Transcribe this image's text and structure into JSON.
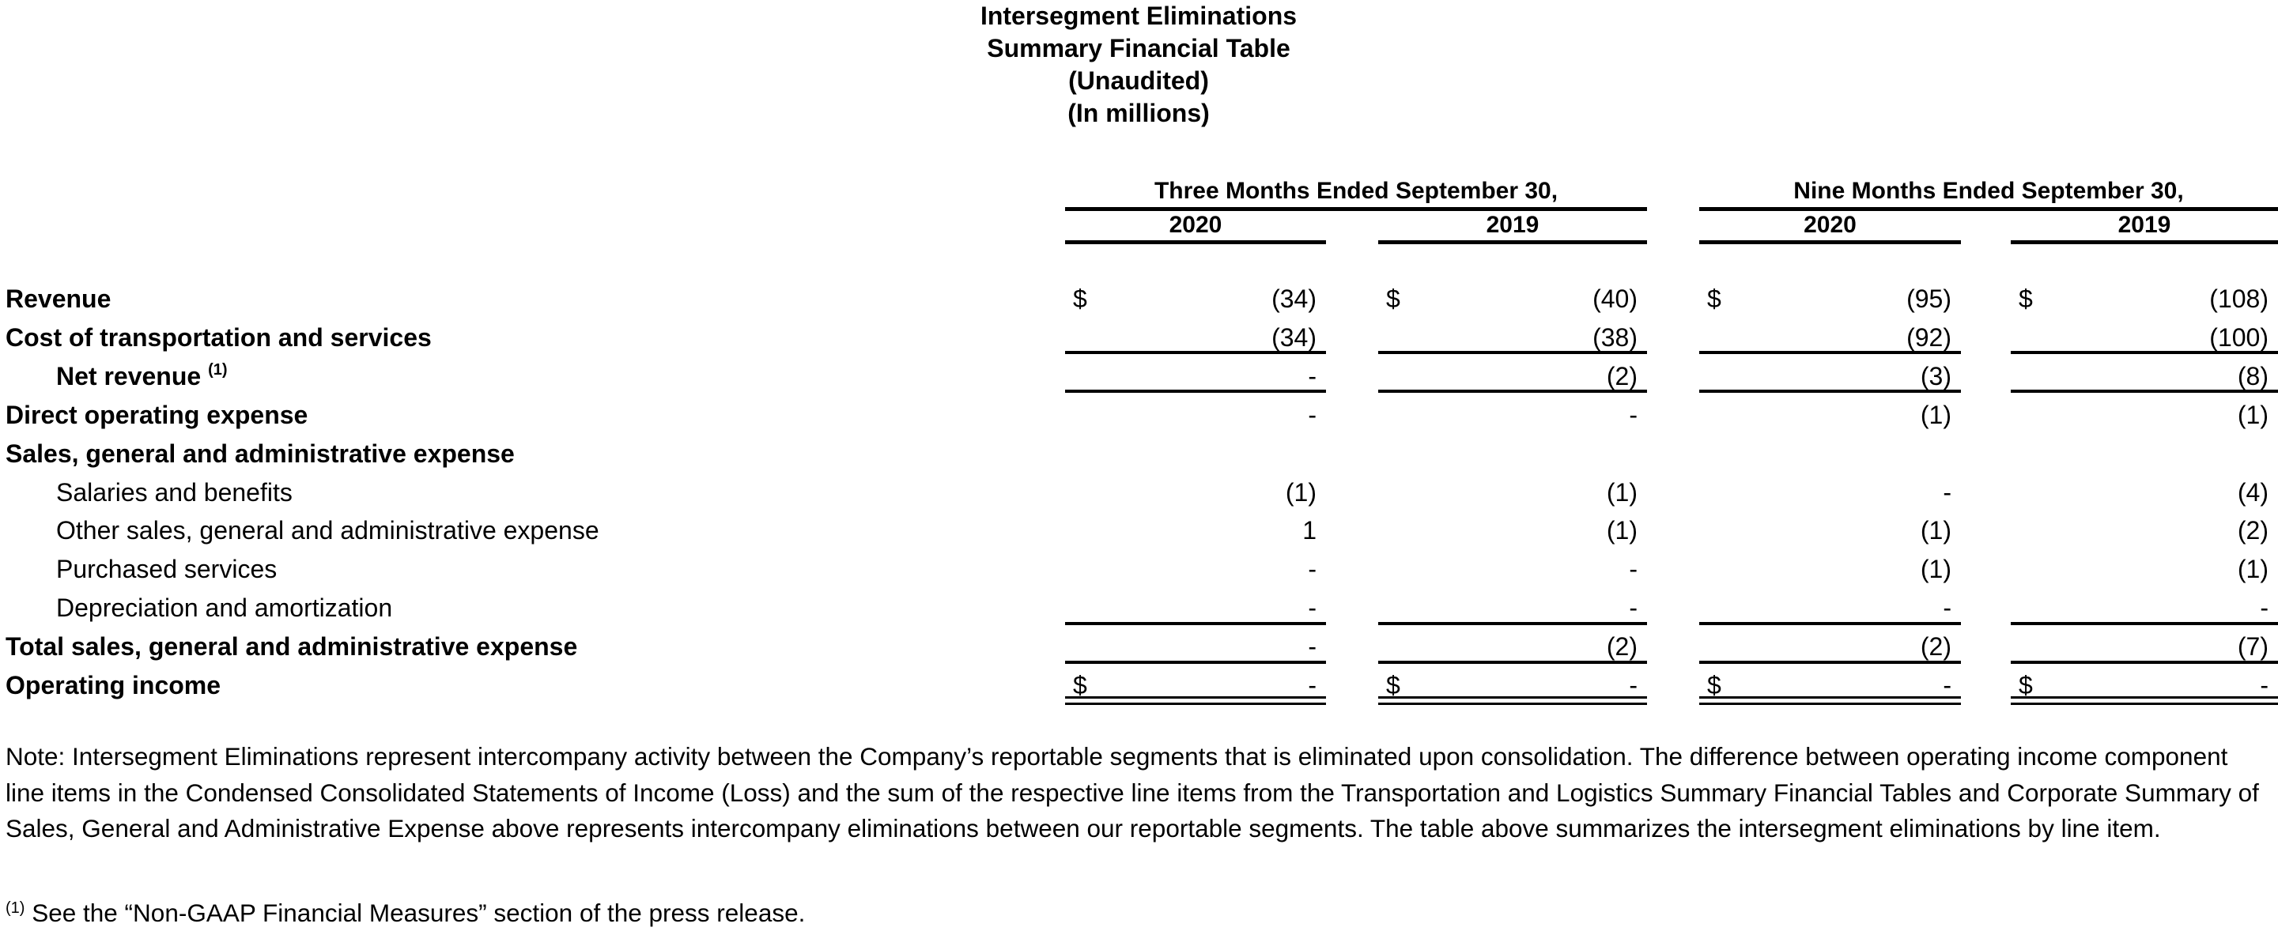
{
  "title": {
    "lines": [
      "Intersegment Eliminations",
      "Summary Financial Table",
      "(Unaudited)",
      "(In millions)"
    ]
  },
  "headers": {
    "groups": [
      {
        "label": "Three Months Ended September 30,"
      },
      {
        "label": "Nine Months Ended September 30,"
      }
    ],
    "years": [
      "2020",
      "2019",
      "2020",
      "2019"
    ]
  },
  "currency_symbol": "$",
  "rows": [
    {
      "label": "Revenue",
      "style": "bold",
      "values": [
        "(34)",
        "(40)",
        "(95)",
        "(108)"
      ],
      "dollar": true
    },
    {
      "label": "Cost of transportation and services",
      "style": "bold",
      "values": [
        "(34)",
        "(38)",
        "(92)",
        "(100)"
      ]
    },
    {
      "label": "Net revenue",
      "footnote_ref": "(1)",
      "style": "bold-indent",
      "values": [
        "-",
        "(2)",
        "(3)",
        "(8)"
      ]
    },
    {
      "label": "Direct operating expense",
      "style": "bold",
      "values": [
        "-",
        "-",
        "(1)",
        "(1)"
      ]
    },
    {
      "label": "Sales, general and administrative expense",
      "style": "bold",
      "values": [
        "",
        "",
        "",
        ""
      ]
    },
    {
      "label": "Salaries and benefits",
      "style": "indent",
      "values": [
        "(1)",
        "(1)",
        "-",
        "(4)"
      ]
    },
    {
      "label": "Other sales, general and administrative expense",
      "style": "indent",
      "values": [
        "1",
        "(1)",
        "(1)",
        "(2)"
      ]
    },
    {
      "label": "Purchased services",
      "style": "indent",
      "values": [
        "-",
        "-",
        "(1)",
        "(1)"
      ]
    },
    {
      "label": "Depreciation and amortization",
      "style": "indent",
      "values": [
        "-",
        "-",
        "-",
        "-"
      ]
    },
    {
      "label": "Total sales, general and administrative expense",
      "style": "bold",
      "values": [
        "-",
        "(2)",
        "(2)",
        "(7)"
      ]
    },
    {
      "label": "Operating income",
      "style": "bold",
      "values": [
        "-",
        "-",
        "-",
        "-"
      ],
      "dollar": true
    }
  ],
  "note": "Note: Intersegment Eliminations represent intercompany activity between the Company’s reportable segments that is eliminated upon consolidation. The difference between operating income component line items in the Condensed Consolidated Statements of Income (Loss) and the sum of the respective line items from the Transportation and Logistics Summary Financial Tables and Corporate Summary of Sales, General and Administrative Expense above represents intercompany eliminations between our reportable segments. The table above summarizes the intersegment eliminations by line item.",
  "footnote": {
    "marker": "(1)",
    "text": "See the “Non-GAAP Financial Measures” section of the press release."
  }
}
